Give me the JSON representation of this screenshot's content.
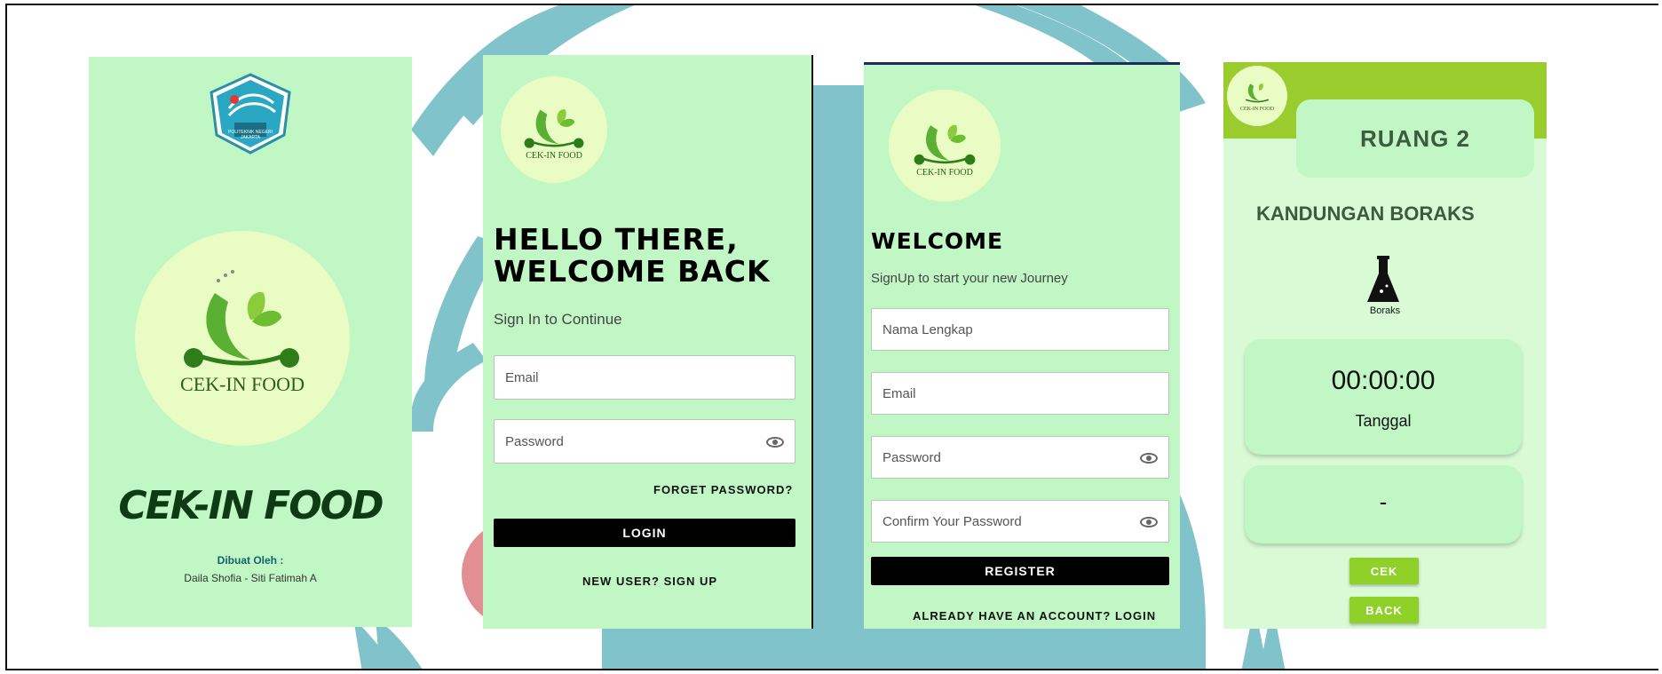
{
  "colors": {
    "panel_green": "#c0f7c5",
    "logo_circle": "#e8fcc4",
    "accent_lime": "#9acc2e",
    "button_black": "#000000",
    "background_teal": "#80c3ca",
    "background_pink": "#e38e93"
  },
  "splash": {
    "badge_text": "POLITEKNIK NEGERI JAKARTA",
    "logo_text": "CEK-IN FOOD",
    "app_title": "CEK-IN FOOD",
    "credit_heading": "Dibuat Oleh :",
    "credit_names": "Daila Shofia - Siti Fatimah A"
  },
  "login": {
    "logo_text": "CEK-IN FOOD",
    "heading_line1": "HELLO THERE,",
    "heading_line2": "WELCOME BACK",
    "subtitle": "Sign In to Continue",
    "email_placeholder": "Email",
    "password_placeholder": "Password",
    "forgot_link": "FORGET PASSWORD?",
    "login_button": "LOGIN",
    "signup_link": "NEW USER? SIGN UP"
  },
  "register": {
    "logo_text": "CEK-IN FOOD",
    "heading": "WELCOME",
    "subtitle": "SignUp to start your new Journey",
    "name_placeholder": "Nama Lengkap",
    "email_placeholder": "Email",
    "password_placeholder": "Password",
    "confirm_placeholder": "Confirm Your Password",
    "register_button": "REGISTER",
    "login_link": "ALREADY HAVE AN ACCOUNT? LOGIN"
  },
  "room": {
    "logo_text": "CEK-IN FOOD",
    "room_title": "RUANG 2",
    "section_title": "KANDUNGAN BORAKS",
    "flask_label": "Boraks",
    "time": "00:00:00",
    "date_label": "Tanggal",
    "result": "-",
    "check_button": "CEK",
    "back_button": "BACK"
  }
}
